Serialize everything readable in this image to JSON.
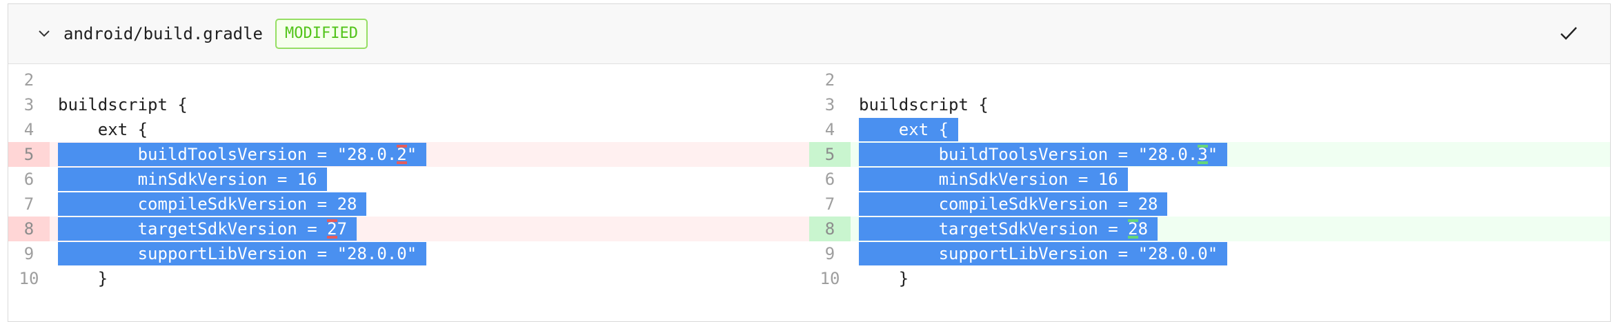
{
  "file": {
    "path": "android/build.gradle",
    "status": "MODIFIED"
  },
  "icons": {
    "collapse": "chevron-down-icon",
    "reviewed": "check-icon"
  },
  "colors": {
    "badge_text": "#52c41a",
    "badge_border": "#95de64",
    "selection": "#4a90f0",
    "deleted_bg": "#fff0f0",
    "added_bg": "#f0fff2"
  },
  "left": {
    "lines": [
      {
        "num": "2",
        "text": ""
      },
      {
        "num": "3",
        "text": "buildscript {"
      },
      {
        "num": "4",
        "text": "    ext {"
      },
      {
        "num": "5",
        "pre": "        buildToolsVersion = \"28.0.",
        "changed": "2",
        "post": "\""
      },
      {
        "num": "6",
        "text": "        minSdkVersion = 16"
      },
      {
        "num": "7",
        "text": "        compileSdkVersion = 28"
      },
      {
        "num": "8",
        "pre": "        targetSdkVersion = ",
        "changed": "2",
        "post": "7"
      },
      {
        "num": "9",
        "text": "        supportLibVersion = \"28.0.0\""
      },
      {
        "num": "10",
        "text": "    }"
      }
    ]
  },
  "right": {
    "lines": [
      {
        "num": "2",
        "text": ""
      },
      {
        "num": "3",
        "text": "buildscript {"
      },
      {
        "num": "4",
        "text": "    ext {"
      },
      {
        "num": "5",
        "pre": "        buildToolsVersion = \"28.0.",
        "changed": "3",
        "post": "\""
      },
      {
        "num": "6",
        "text": "        minSdkVersion = 16"
      },
      {
        "num": "7",
        "text": "        compileSdkVersion = 28"
      },
      {
        "num": "8",
        "pre": "        targetSdkVersion = ",
        "changed": "2",
        "post": "8"
      },
      {
        "num": "9",
        "text": "        supportLibVersion = \"28.0.0\""
      },
      {
        "num": "10",
        "text": "    }"
      }
    ]
  }
}
